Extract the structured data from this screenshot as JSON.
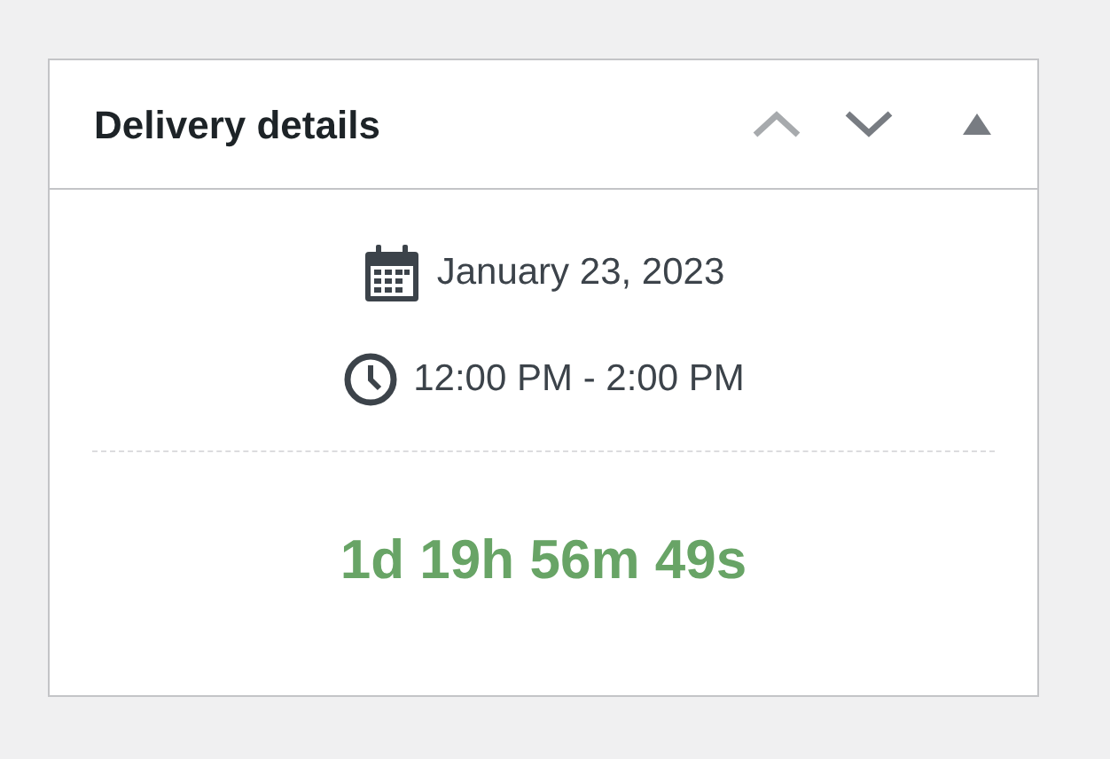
{
  "metabox": {
    "title": "Delivery details",
    "controls": [
      {
        "kind": "up",
        "disabled": true
      },
      {
        "kind": "down",
        "disabled": false
      },
      {
        "kind": "toggle",
        "disabled": false
      }
    ],
    "date": "January 23, 2023",
    "time": "12:00 PM - 2:00 PM",
    "countdown": "1d 19h 56m 49s"
  }
}
